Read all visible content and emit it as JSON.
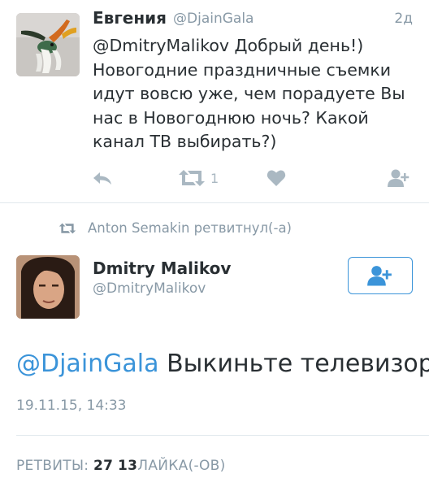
{
  "tweet": {
    "author_name": "Евгения",
    "author_handle": "@DjainGala",
    "time": "2д",
    "text": "@DmitryMalikov Добрый день!)\nНовогодние праздничные съемки идут вовсю уже, чем порадуете Вы нас в Новогоднюю ночь? Какой канал ТВ выбирать?)",
    "retweet_count": "1"
  },
  "retweet_context": {
    "text": "Anton Semakin ретвитнул(-а)"
  },
  "main_tweet": {
    "author_name": "Dmitry Malikov",
    "author_handle": "@DmitryMalikov",
    "mention": "@DjainGala",
    "body": " Выкиньте телевизор",
    "date": "19.11.15, 14:33",
    "retweets_label": "РЕТВИТЫ:",
    "retweets_count": "27",
    "likes_count": "13",
    "likes_label": "ЛАЙКА(-ОВ)"
  },
  "icons": {
    "reply": "reply-icon",
    "retweet": "retweet-icon",
    "like": "heart-icon",
    "follow": "add-user-icon",
    "bird_avatar": "hummingbird-avatar",
    "person_avatar": "person-avatar"
  },
  "colors": {
    "accent": "#3b94d9",
    "muted": "#8899a6",
    "icon": "#aab8c2",
    "text": "#292f33"
  }
}
